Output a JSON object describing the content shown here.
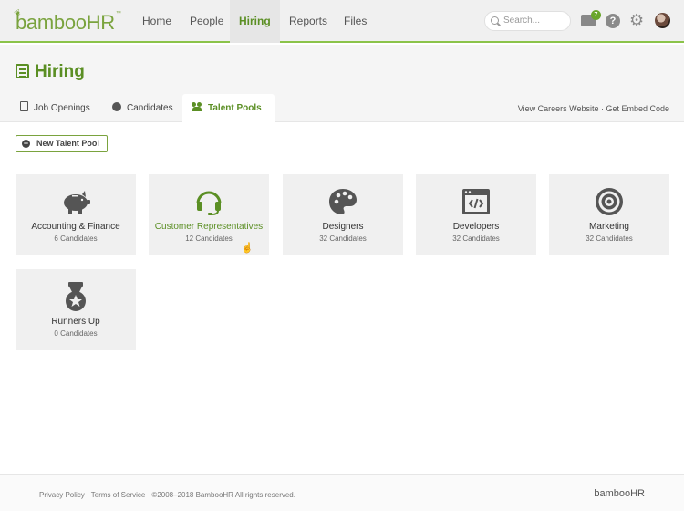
{
  "nav": {
    "logo": "bambooHR",
    "logo_tm": "™",
    "links": [
      "Home",
      "People",
      "Hiring",
      "Reports",
      "Files"
    ],
    "active": "Hiring",
    "search_placeholder": "Search...",
    "inbox_count": "7",
    "help_label": "?"
  },
  "header": {
    "title": "Hiring",
    "tabs": [
      "Job Openings",
      "Candidates",
      "Talent Pools"
    ],
    "active_tab": "Talent Pools",
    "career_links": "View Careers Website · Get Embed Code"
  },
  "toolbar": {
    "new_pool_label": "New Talent Pool"
  },
  "pools": [
    {
      "name": "Accounting & Finance",
      "count": "6 Candidates",
      "icon": "piggy-bank-icon"
    },
    {
      "name": "Customer Representatives",
      "count": "12 Candidates",
      "icon": "headset-icon"
    },
    {
      "name": "Designers",
      "count": "32 Candidates",
      "icon": "palette-icon"
    },
    {
      "name": "Developers",
      "count": "32 Candidates",
      "icon": "code-window-icon"
    },
    {
      "name": "Marketing",
      "count": "32 Candidates",
      "icon": "target-icon"
    },
    {
      "name": "Runners Up",
      "count": "0 Candidates",
      "icon": "medal-icon"
    }
  ],
  "footer": {
    "links": "Privacy Policy · Terms of Service · ©2008–2018 BambooHR All rights reserved.",
    "logo": "bambooHR"
  },
  "colors": {
    "brand": "#5b8f24",
    "card_bg": "#f0f0f0",
    "icon": "#555555"
  }
}
